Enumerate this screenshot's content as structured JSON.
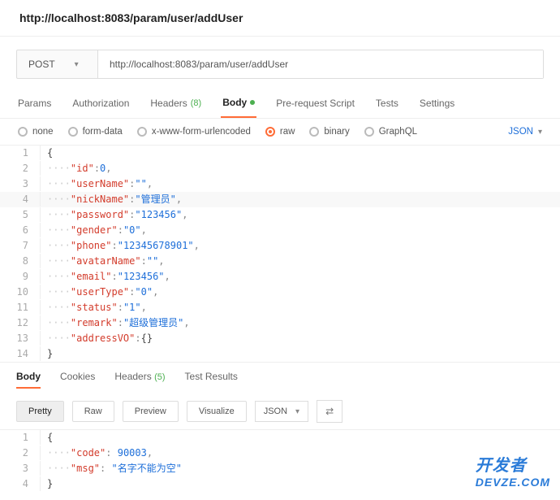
{
  "title": "http://localhost:8083/param/user/addUser",
  "request": {
    "method": "POST",
    "url": "http://localhost:8083/param/user/addUser"
  },
  "tabs": {
    "params": "Params",
    "auth": "Authorization",
    "headers": "Headers",
    "headers_count": "(8)",
    "body": "Body",
    "prereq": "Pre-request Script",
    "tests": "Tests",
    "settings": "Settings"
  },
  "body_types": {
    "none": "none",
    "formdata": "form-data",
    "xwww": "x-www-form-urlencoded",
    "raw": "raw",
    "binary": "binary",
    "graphql": "GraphQL",
    "format": "JSON"
  },
  "req_body_lines": [
    {
      "n": 1,
      "indent": "",
      "text": "{",
      "cls": "brk"
    },
    {
      "n": 2,
      "indent": "····",
      "key": "\"id\"",
      "val": "0",
      "vcls": "num",
      "tail": ","
    },
    {
      "n": 3,
      "indent": "····",
      "key": "\"userName\"",
      "val": "\"\"",
      "vcls": "str",
      "tail": ","
    },
    {
      "n": 4,
      "indent": "····",
      "key": "\"nickName\"",
      "val": "\"管理员\"",
      "vcls": "str",
      "tail": ",",
      "hl": true
    },
    {
      "n": 5,
      "indent": "····",
      "key": "\"password\"",
      "val": "\"123456\"",
      "vcls": "str",
      "tail": ","
    },
    {
      "n": 6,
      "indent": "····",
      "key": "\"gender\"",
      "val": "\"0\"",
      "vcls": "str",
      "tail": ","
    },
    {
      "n": 7,
      "indent": "····",
      "key": "\"phone\"",
      "val": "\"12345678901\"",
      "vcls": "str",
      "tail": ","
    },
    {
      "n": 8,
      "indent": "····",
      "key": "\"avatarName\"",
      "val": "\"\"",
      "vcls": "str",
      "tail": ","
    },
    {
      "n": 9,
      "indent": "····",
      "key": "\"email\"",
      "val": "\"123456\"",
      "vcls": "str",
      "tail": ","
    },
    {
      "n": 10,
      "indent": "····",
      "key": "\"userType\"",
      "val": "\"0\"",
      "vcls": "str",
      "tail": ","
    },
    {
      "n": 11,
      "indent": "····",
      "key": "\"status\"",
      "val": "\"1\"",
      "vcls": "str",
      "tail": ","
    },
    {
      "n": 12,
      "indent": "····",
      "key": "\"remark\"",
      "val": "\"超级管理员\"",
      "vcls": "str",
      "tail": ","
    },
    {
      "n": 13,
      "indent": "····",
      "key": "\"addressVO\"",
      "val": "{}",
      "vcls": "brk",
      "tail": ""
    },
    {
      "n": 14,
      "indent": "",
      "text": "}",
      "cls": "brk"
    }
  ],
  "resp_tabs": {
    "body": "Body",
    "cookies": "Cookies",
    "headers": "Headers",
    "headers_count": "(5)",
    "tests": "Test Results"
  },
  "resp_controls": {
    "pretty": "Pretty",
    "raw": "Raw",
    "preview": "Preview",
    "visualize": "Visualize",
    "format": "JSON"
  },
  "resp_body_lines": [
    {
      "n": 1,
      "indent": "",
      "text": "{",
      "cls": "brk"
    },
    {
      "n": 2,
      "indent": "····",
      "key": "\"code\"",
      "val": " 90003",
      "vcls": "num",
      "tail": ","
    },
    {
      "n": 3,
      "indent": "····",
      "key": "\"msg\"",
      "val": " \"名字不能为空\"",
      "vcls": "str",
      "tail": ""
    },
    {
      "n": 4,
      "indent": "",
      "text": "}",
      "cls": "brk"
    }
  ],
  "watermark": "开发者  DevZe.CoM"
}
